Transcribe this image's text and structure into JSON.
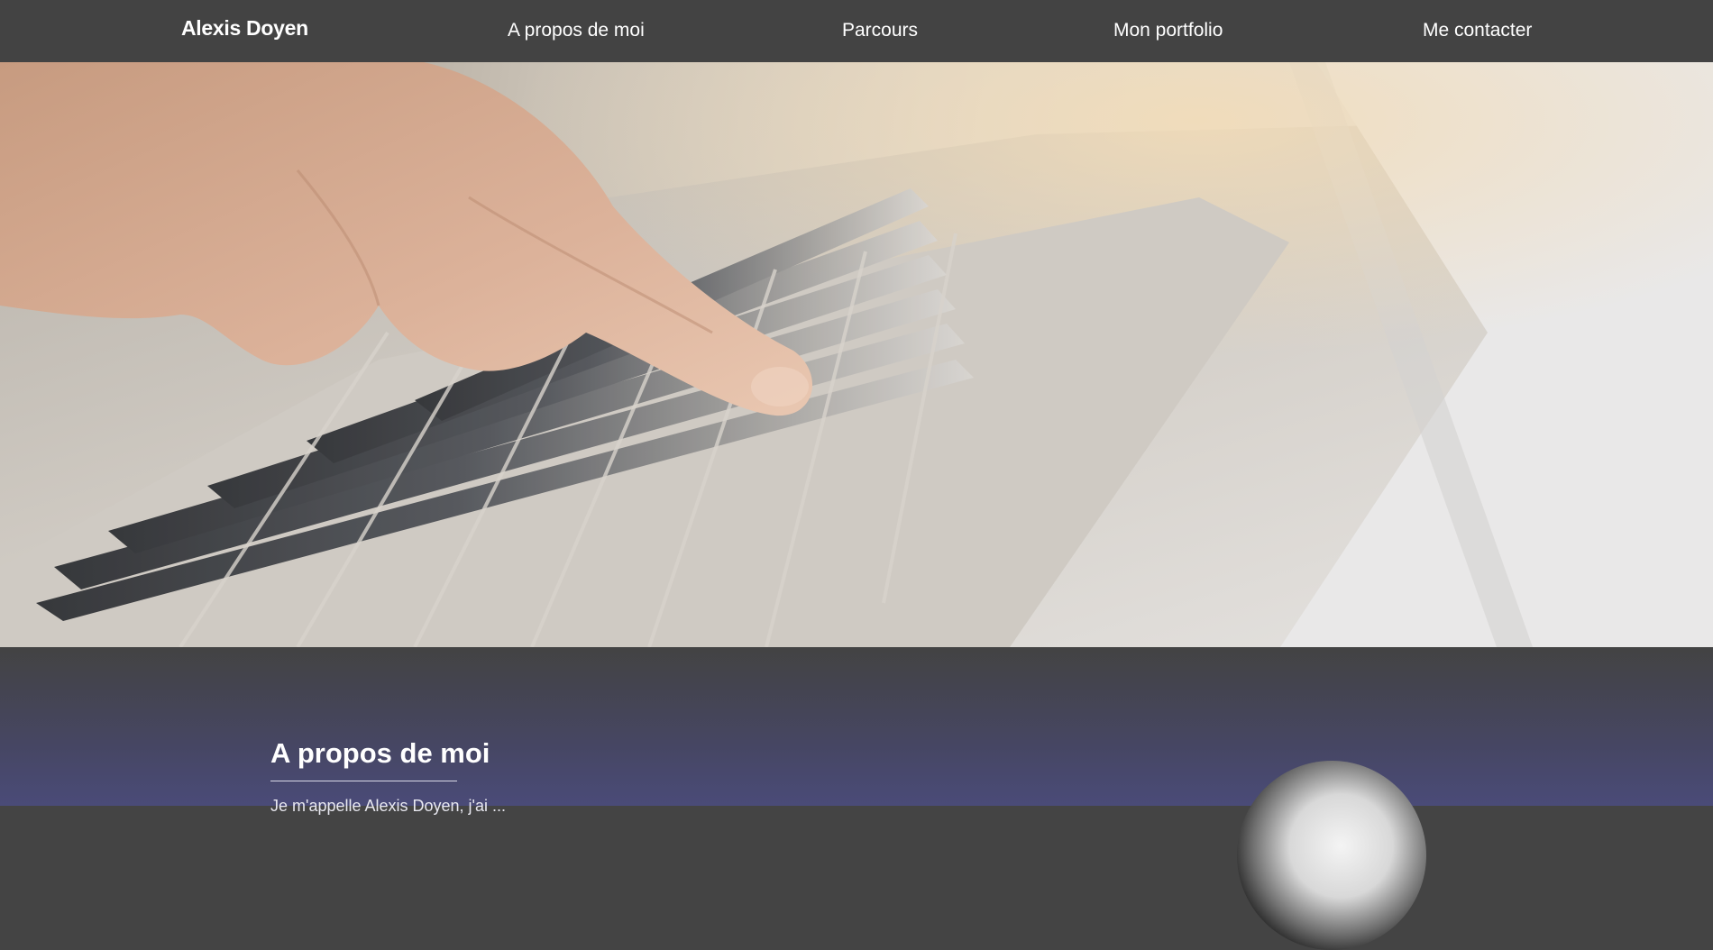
{
  "navbar": {
    "brand": "Alexis Doyen",
    "links": [
      "A propos de moi",
      "Parcours",
      "Mon portfolio",
      "Me contacter"
    ]
  },
  "hero": {
    "image": "hand-typing-on-laptop-keyboard"
  },
  "about": {
    "title": "A propos de moi",
    "intro": "Je m'appelle Alexis Doyen, j'ai ...",
    "avatar": "profile-photo-black-and-white"
  },
  "colors": {
    "navbar_bg": "#434343",
    "section_gradient_top": "#434343",
    "section_gradient_bottom": "#4a4b78",
    "text": "#ffffff"
  }
}
